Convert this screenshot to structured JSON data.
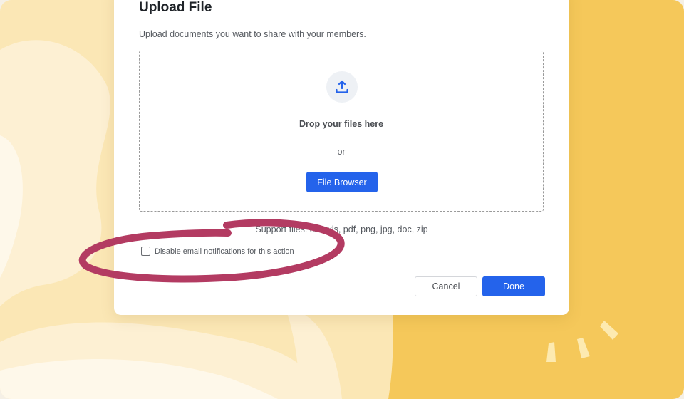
{
  "theme": {
    "bg_light": "#fbe7b5",
    "bg_cream": "#fdf3dc",
    "bg_yellow": "#f5c85a",
    "accent_blue": "#2463eb",
    "annotation_color": "#b33b62"
  },
  "dialog": {
    "title": "Upload File",
    "subtitle": "Upload documents you want to share with your members.",
    "dropzone": {
      "icon": "upload-icon",
      "drop_text": "Drop your files here",
      "or_text": "or",
      "browse_label": "File Browser"
    },
    "support_text": "Support files: csv, xls, pdf, png, jpg, doc, zip",
    "notification_option": {
      "label": "Disable email notifications for this action",
      "checked": false
    },
    "actions": {
      "cancel_label": "Cancel",
      "done_label": "Done"
    }
  }
}
